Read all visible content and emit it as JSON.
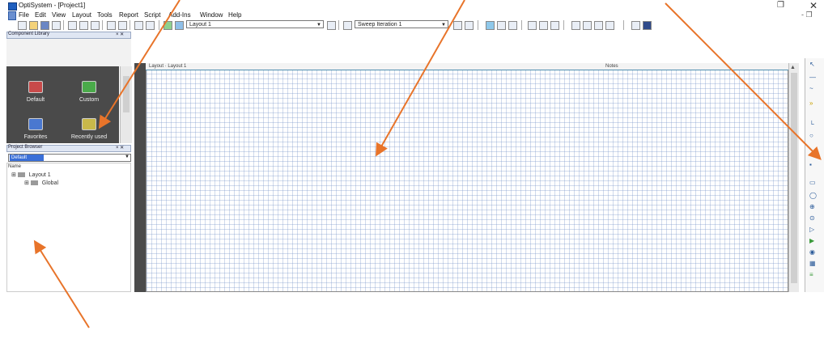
{
  "window": {
    "title": "OptiSystem - [Project1]",
    "restore_glyph": "❐",
    "close_glyph": "✕",
    "mdi_controls": "- ❐"
  },
  "menu": {
    "items": [
      "File",
      "Edit",
      "View",
      "Layout",
      "Tools",
      "Report",
      "Script",
      "Add-Ins",
      "Window",
      "Help"
    ]
  },
  "toolbar": {
    "layout_combo": "Layout 1",
    "sweep_combo": "Sweep Iteration 1"
  },
  "component_library": {
    "title": "Component Library",
    "header_buttons": "× ✕",
    "items": [
      {
        "label": "Default",
        "icon": "folder-red-icon",
        "color": "#c84a4a"
      },
      {
        "label": "Custom",
        "icon": "folder-green-icon",
        "color": "#4aaa4a"
      },
      {
        "label": "Favorites",
        "icon": "folder-blue-icon",
        "color": "#4a78d0"
      },
      {
        "label": "Recently used",
        "icon": "folder-yellow-icon",
        "color": "#c8b84a"
      }
    ]
  },
  "project_browser": {
    "title": "Project Browser",
    "header_buttons": "× ✕",
    "combo_value": "Default",
    "column_header": "Name",
    "tree": [
      {
        "label": "Layout 1",
        "depth": 0
      },
      {
        "label": "Global",
        "depth": 1
      }
    ]
  },
  "layout_editor": {
    "tab_label": "Layout · Layout 1",
    "notes_label": "Notes"
  },
  "colors": {
    "arrow": "#e8742a",
    "grid": "#7896c8"
  }
}
